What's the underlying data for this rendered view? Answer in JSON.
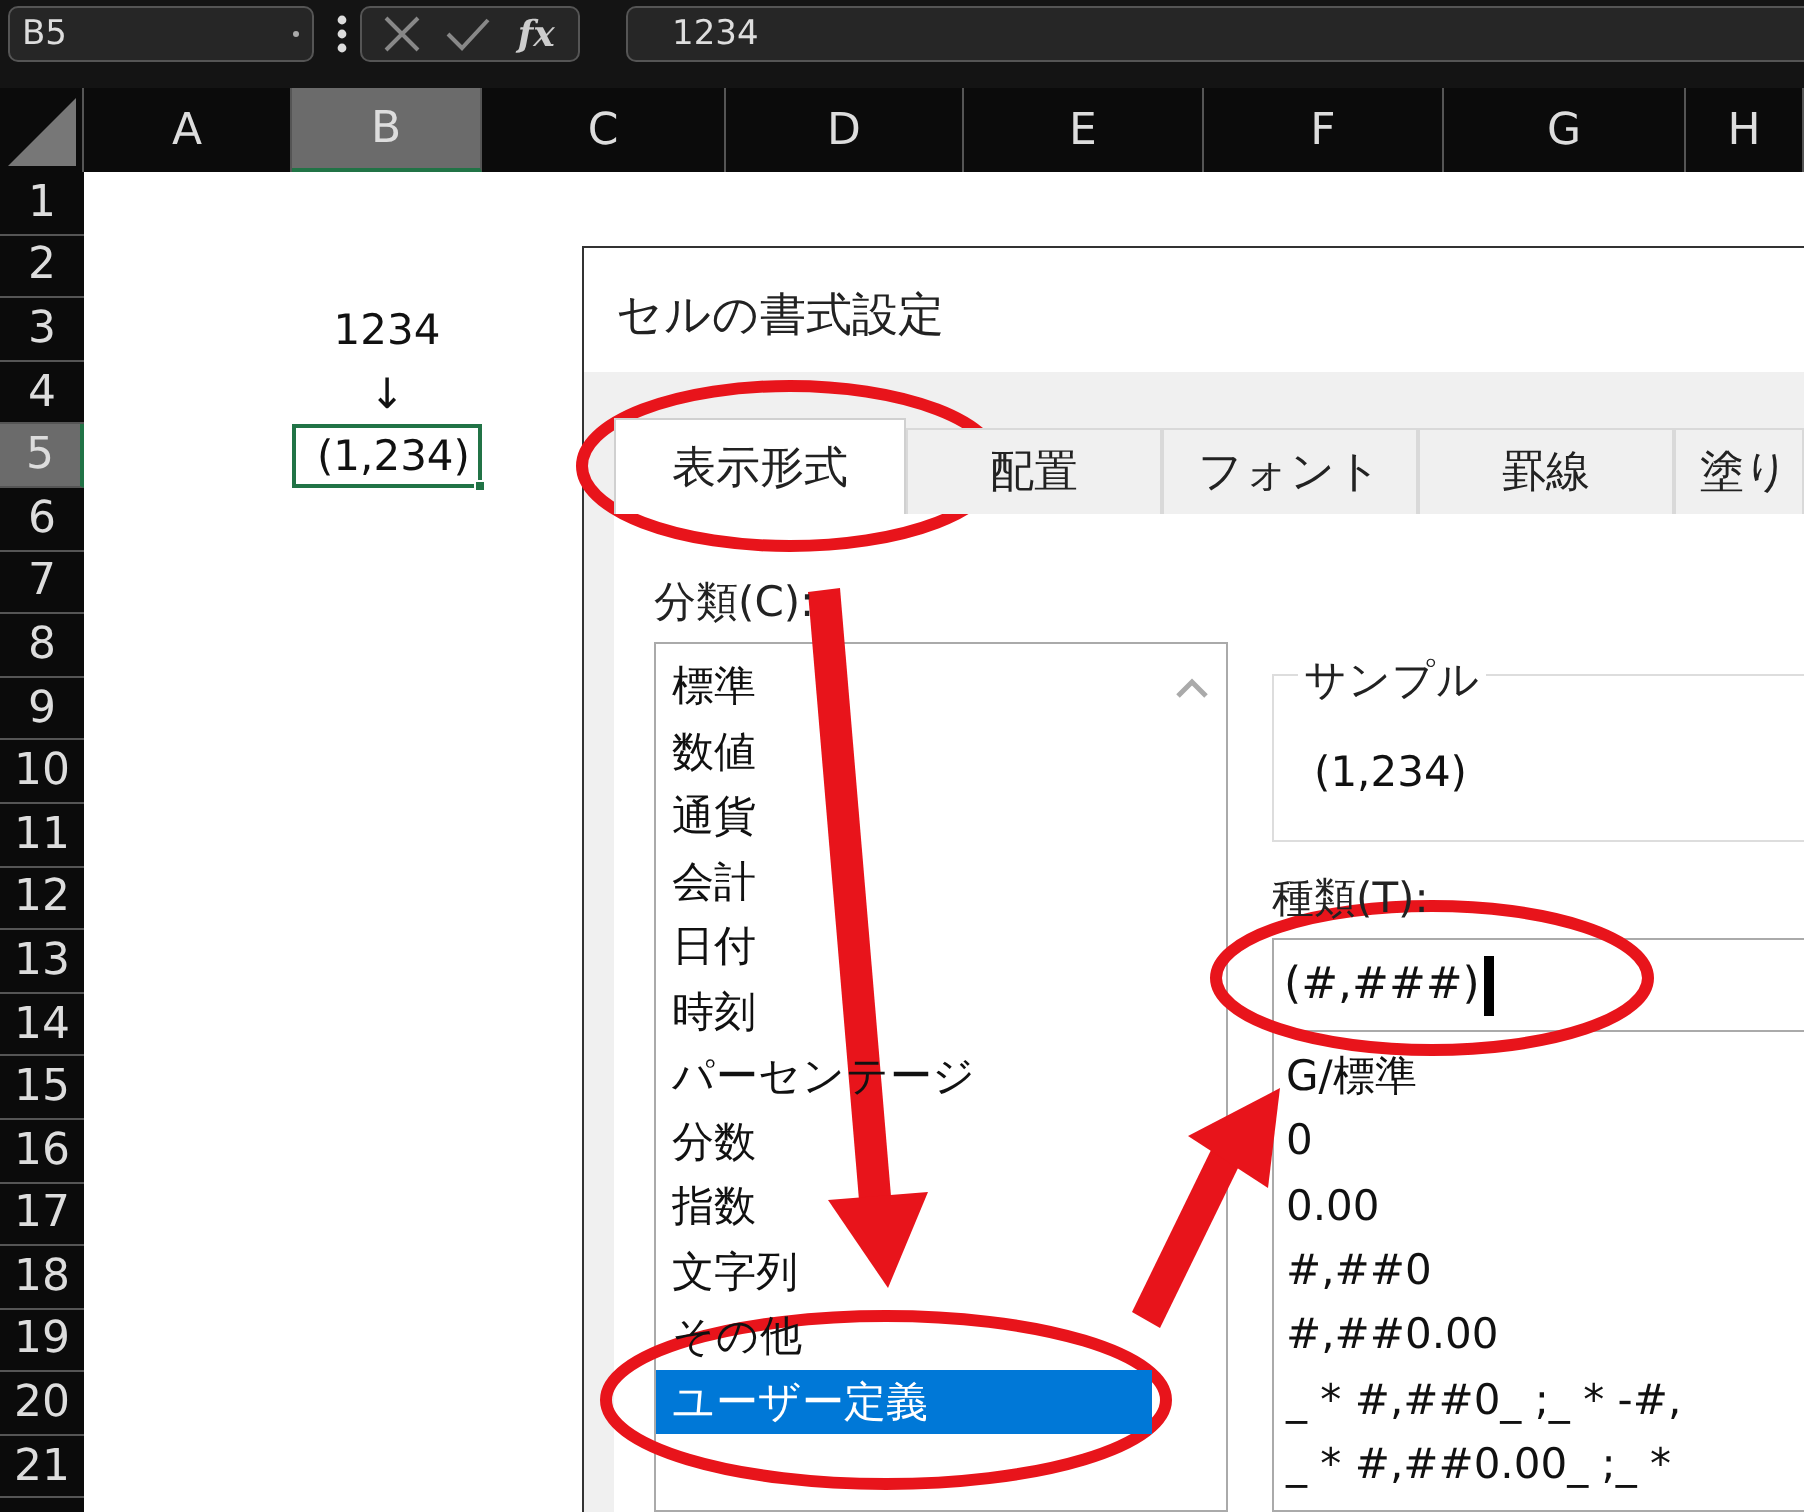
{
  "formula_bar": {
    "name_box": "B5",
    "function_button": "fx",
    "formula": "1234"
  },
  "columns": [
    {
      "label": "A",
      "selected": false
    },
    {
      "label": "B",
      "selected": true
    },
    {
      "label": "C",
      "selected": false
    },
    {
      "label": "D",
      "selected": false
    },
    {
      "label": "E",
      "selected": false
    },
    {
      "label": "F",
      "selected": false
    },
    {
      "label": "G",
      "selected": false
    },
    {
      "label": "H",
      "selected": false
    }
  ],
  "rows": [
    {
      "label": "1",
      "selected": false
    },
    {
      "label": "2",
      "selected": false
    },
    {
      "label": "3",
      "selected": false
    },
    {
      "label": "4",
      "selected": false
    },
    {
      "label": "5",
      "selected": true
    },
    {
      "label": "6",
      "selected": false
    },
    {
      "label": "7",
      "selected": false
    },
    {
      "label": "8",
      "selected": false
    },
    {
      "label": "9",
      "selected": false
    },
    {
      "label": "10",
      "selected": false
    },
    {
      "label": "11",
      "selected": false
    },
    {
      "label": "12",
      "selected": false
    },
    {
      "label": "13",
      "selected": false
    },
    {
      "label": "14",
      "selected": false
    },
    {
      "label": "15",
      "selected": false
    },
    {
      "label": "16",
      "selected": false
    },
    {
      "label": "17",
      "selected": false
    },
    {
      "label": "18",
      "selected": false
    },
    {
      "label": "19",
      "selected": false
    },
    {
      "label": "20",
      "selected": false
    },
    {
      "label": "21",
      "selected": false
    }
  ],
  "cells": [
    {
      "text": "1234",
      "selected": false
    },
    {
      "text": "↓",
      "selected": false
    },
    {
      "text": "(1,234)",
      "selected": true
    }
  ],
  "dialog": {
    "title": "セルの書式設定",
    "tabs": [
      {
        "label": "表示形式",
        "selected": true
      },
      {
        "label": "配置",
        "selected": false
      },
      {
        "label": "フォント",
        "selected": false
      },
      {
        "label": "罫線",
        "selected": false
      },
      {
        "label": "塗り",
        "selected": false
      }
    ],
    "category_label": "分類(C):",
    "categories": [
      {
        "label": "標準",
        "selected": false
      },
      {
        "label": "数値",
        "selected": false
      },
      {
        "label": "通貨",
        "selected": false
      },
      {
        "label": "会計",
        "selected": false
      },
      {
        "label": "日付",
        "selected": false
      },
      {
        "label": "時刻",
        "selected": false
      },
      {
        "label": "パーセンテージ",
        "selected": false
      },
      {
        "label": "分数",
        "selected": false
      },
      {
        "label": "指数",
        "selected": false
      },
      {
        "label": "文字列",
        "selected": false
      },
      {
        "label": "その他",
        "selected": false
      },
      {
        "label": "ユーザー定義",
        "selected": true
      }
    ],
    "sample": {
      "label": "サンプル",
      "value": "(1,234)"
    },
    "type_label": "種類(T):",
    "type_value": "(#,###)",
    "formats": [
      "G/標準",
      "0",
      "0.00",
      "#,##0",
      "#,##0.00",
      "_ * #,##0_ ;_ * -#,",
      "_ * #,##0.00_ ;_ *"
    ]
  }
}
